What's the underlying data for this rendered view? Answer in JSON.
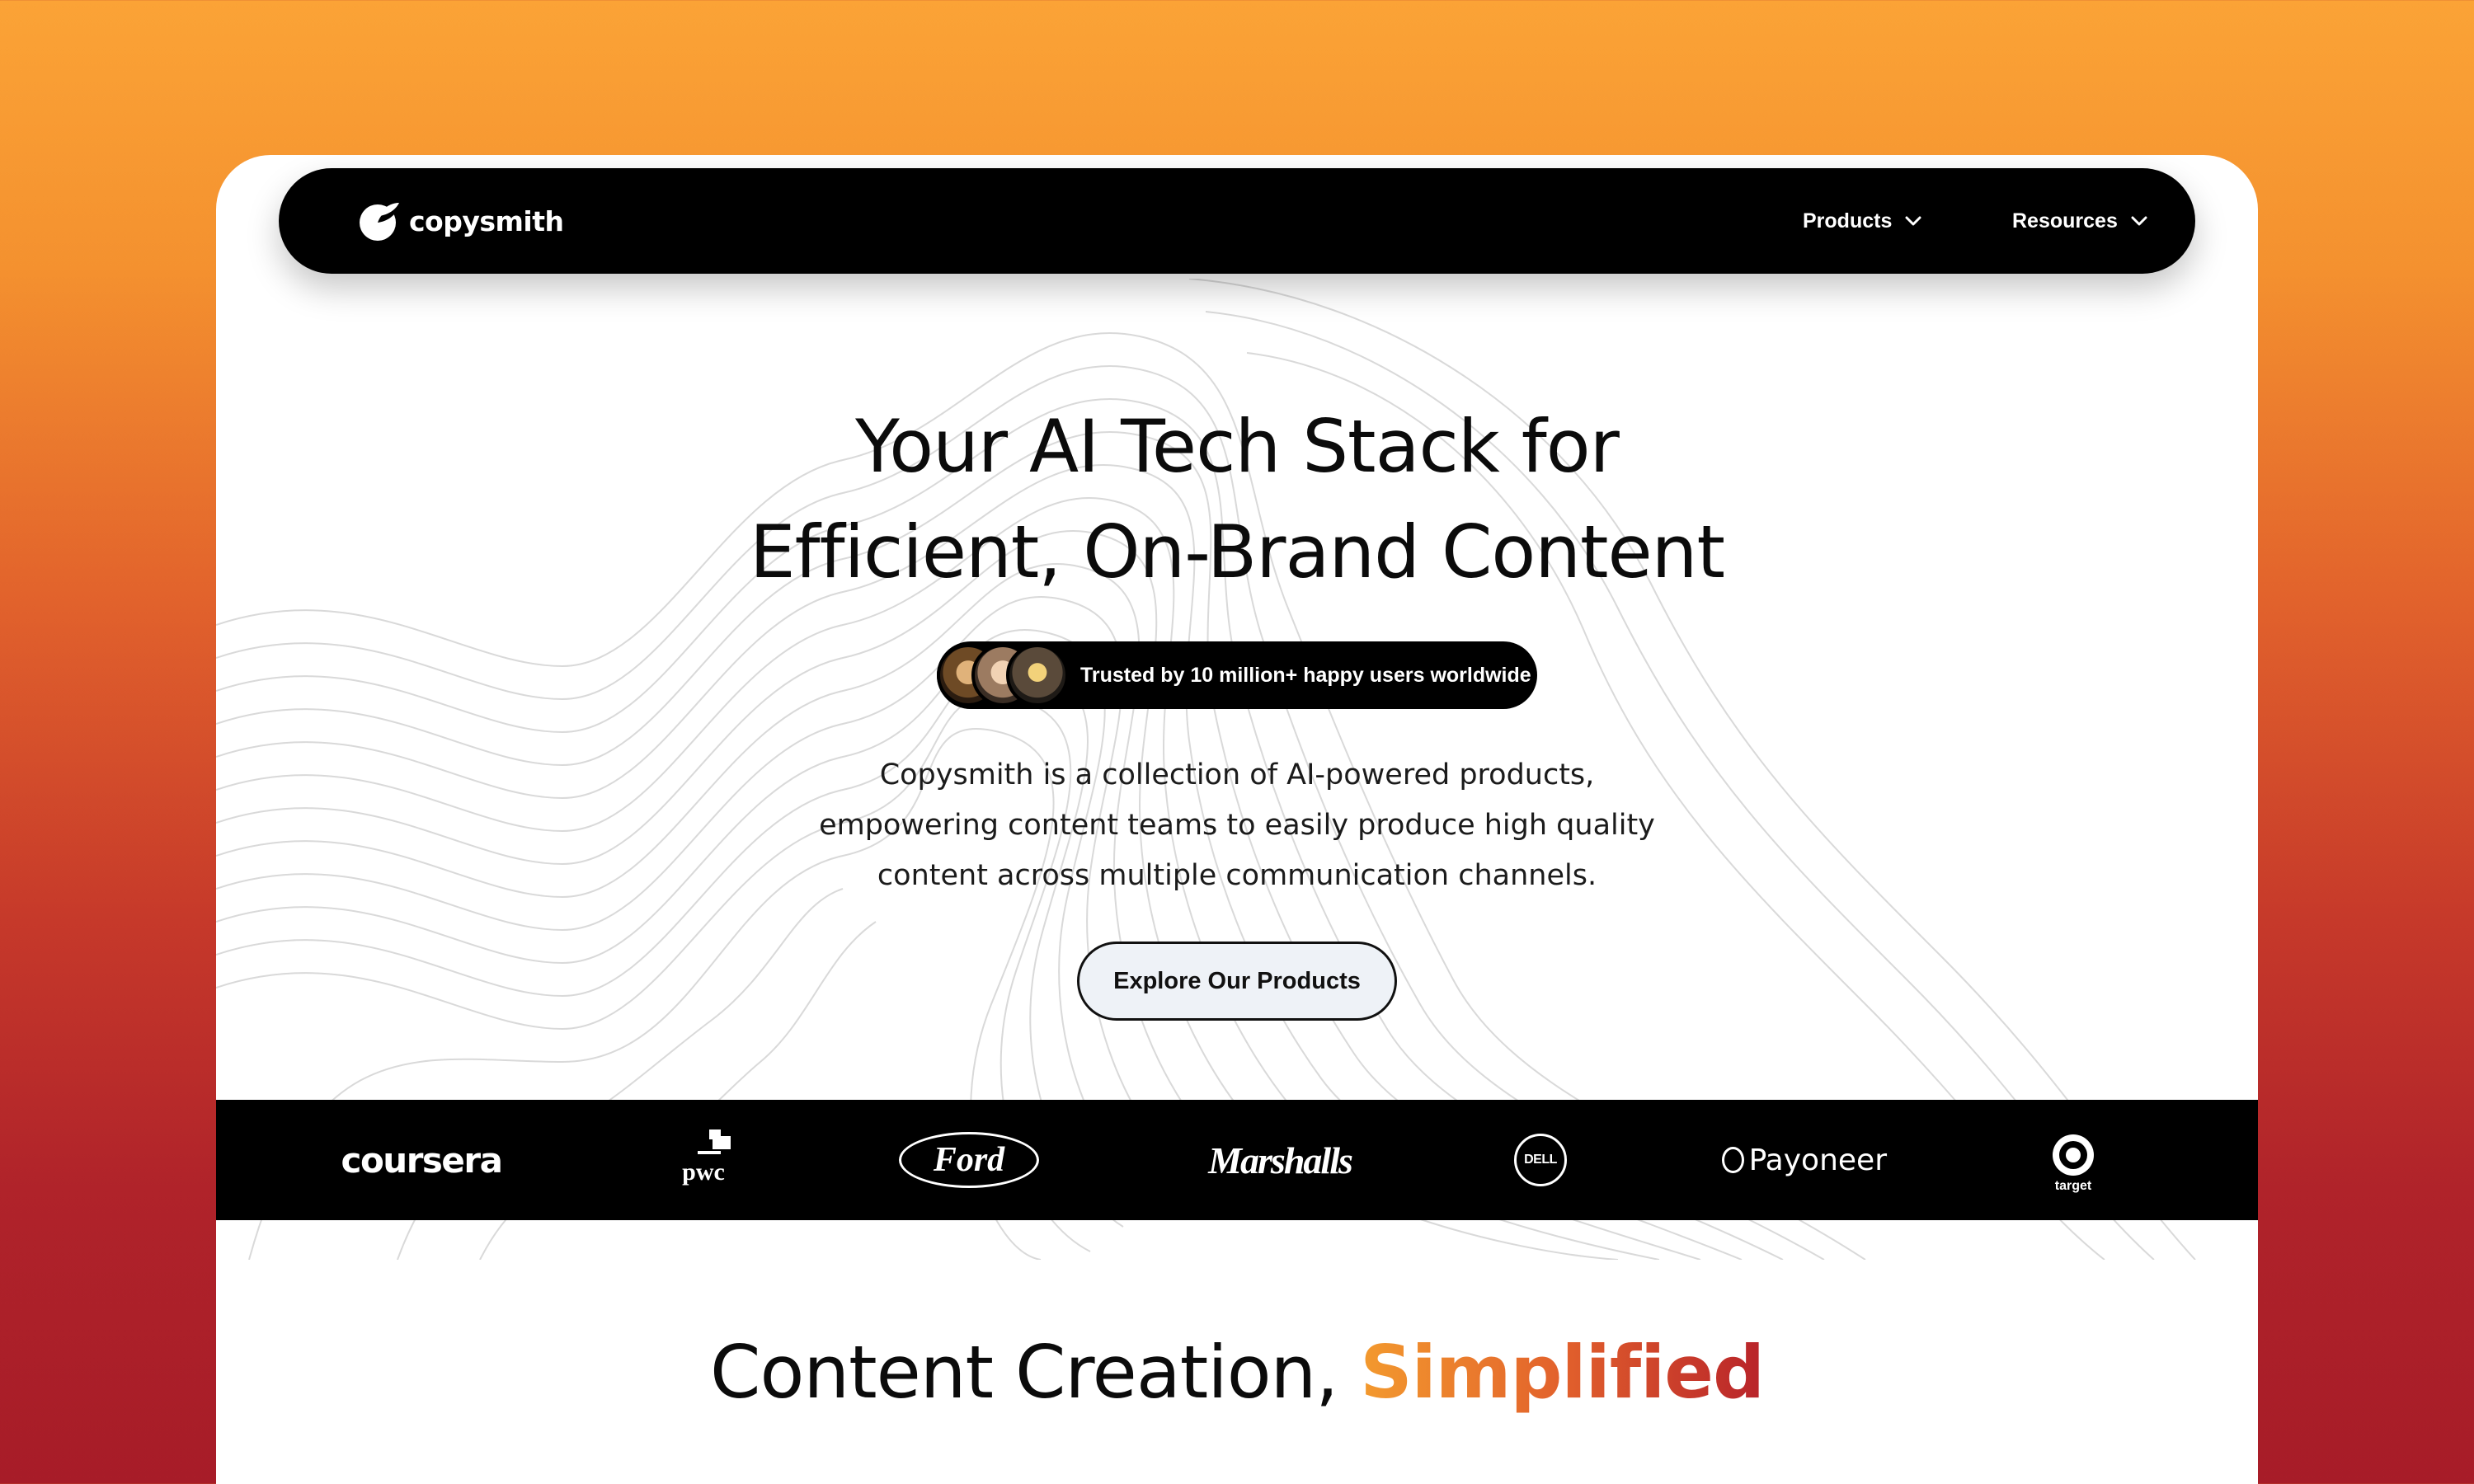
{
  "nav": {
    "logo_text": "copysmith",
    "items": [
      {
        "label": "Products"
      },
      {
        "label": "Resources"
      }
    ]
  },
  "hero": {
    "title_line1": "Your AI Tech Stack for",
    "title_line2": "Efficient, On-Brand Content",
    "trust_badge": "Trusted by 10 million+ happy users worldwide",
    "description_line1": "Copysmith is a collection of AI-powered products,",
    "description_line2": "empowering content teams to easily produce high quality",
    "description_line3": "content across multiple communication channels.",
    "cta_label": "Explore Our Products"
  },
  "brands": {
    "coursera": "coursera",
    "pwc": "pwc",
    "ford": "Ford",
    "marshalls": "Marshalls",
    "dell": "DELL",
    "payoneer": "Payoneer",
    "target": "target"
  },
  "section": {
    "title_prefix": "Content Creation, ",
    "title_accent": "Simplified"
  },
  "colors": {
    "background_top": "#fba336",
    "background_bottom": "#a71c28",
    "navbar": "#000000",
    "cta_background": "#eef2f7",
    "accent_start": "#f39a2e",
    "accent_end": "#b8232a"
  },
  "icons": {
    "logo": "copysmith-logo-icon",
    "dropdown": "chevron-down-icon"
  }
}
